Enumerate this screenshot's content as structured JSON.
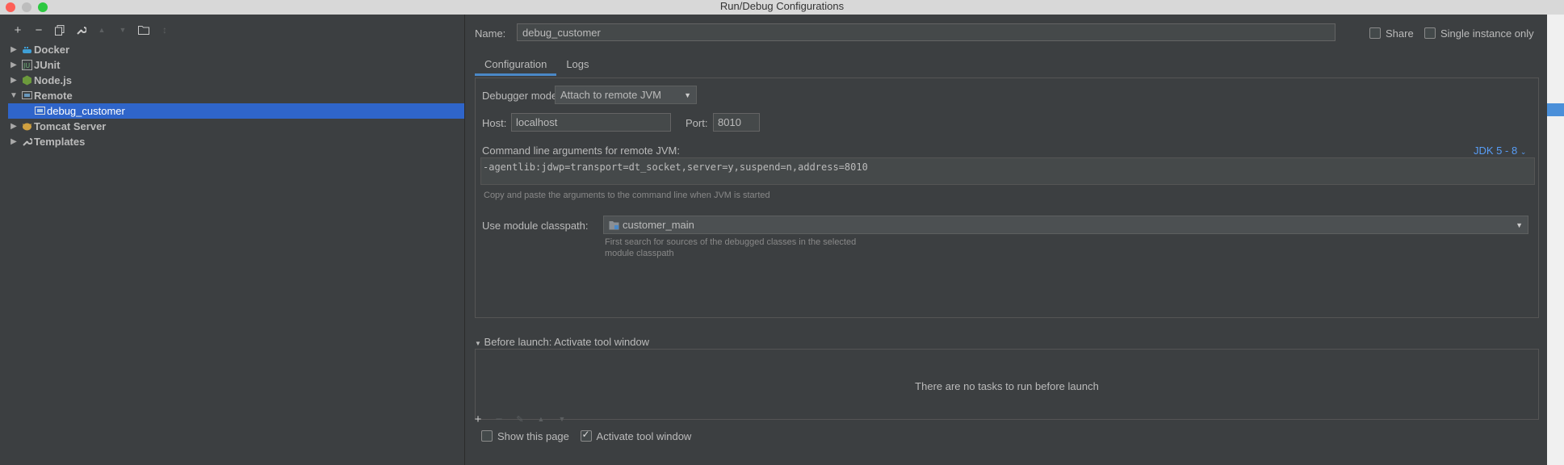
{
  "window": {
    "title": "Run/Debug Configurations"
  },
  "tree": {
    "items": [
      {
        "label": "Docker",
        "icon": "docker-icon",
        "expanded": false
      },
      {
        "label": "JUnit",
        "icon": "junit-icon",
        "expanded": false
      },
      {
        "label": "Node.js",
        "icon": "nodejs-icon",
        "expanded": false
      },
      {
        "label": "Remote",
        "icon": "remote-icon",
        "expanded": true
      },
      {
        "label": "debug_customer",
        "icon": "remote-config-icon",
        "selected": true
      },
      {
        "label": "Tomcat Server",
        "icon": "tomcat-icon",
        "expanded": false
      },
      {
        "label": "Templates",
        "icon": "wrench-icon",
        "expanded": false
      }
    ]
  },
  "toolbar": {
    "add": "+",
    "remove": "−",
    "copy": "⧉",
    "edit": "🔧",
    "up": "▲",
    "down": "▼",
    "folder": "📁",
    "sort": "↕"
  },
  "form": {
    "name_label": "Name:",
    "name_value": "debug_customer",
    "share_label": "Share",
    "single_instance_label": "Single instance only",
    "tabs": [
      "Configuration",
      "Logs"
    ],
    "debugger_mode_label": "Debugger mode:",
    "debugger_mode_value": "Attach to remote JVM",
    "host_label": "Host:",
    "host_value": "localhost",
    "port_label": "Port:",
    "port_value": "8010",
    "cmdline_label": "Command line arguments for remote JVM:",
    "jdk_link": "JDK 5 - 8",
    "cmdline_value": "-agentlib:jdwp=transport=dt_socket,server=y,suspend=n,address=8010",
    "cmdline_hint": "Copy and paste the arguments to the command line when JVM is started",
    "module_label": "Use module classpath:",
    "module_value": "customer_main",
    "module_hint_1": "First search for sources of the debugged classes in the selected",
    "module_hint_2": "module classpath"
  },
  "before_launch": {
    "header": "Before launch: Activate tool window",
    "empty_text": "There are no tasks to run before launch",
    "show_page_label": "Show this page",
    "activate_label": "Activate tool window"
  },
  "colors": {
    "selection": "#2f65ca",
    "link": "#589df6",
    "background": "#3c3f41"
  }
}
